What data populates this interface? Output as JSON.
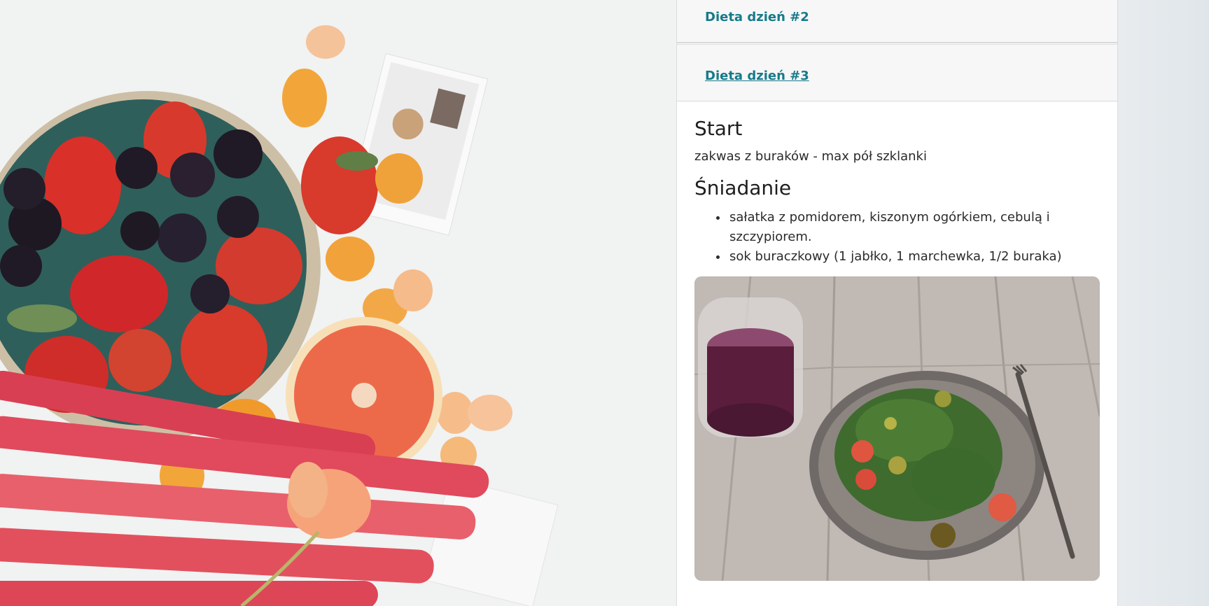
{
  "accordion": {
    "day2_label": "Dieta dzień #2",
    "day3_label": "Dieta dzień #3"
  },
  "day3": {
    "start": {
      "title": "Start",
      "text": "zakwas z buraków - max pół szklanki"
    },
    "breakfast": {
      "title": "Śniadanie",
      "items": [
        "sałatka z pomidorem, kiszonym ogórkiem, cebulą i szczypiorem.",
        "sok buraczkowy (1 jabłko, 1 marchewka, 1/2 buraka)"
      ]
    }
  },
  "colors": {
    "link": "#177a8a",
    "header_bg": "#f7f7f7"
  }
}
